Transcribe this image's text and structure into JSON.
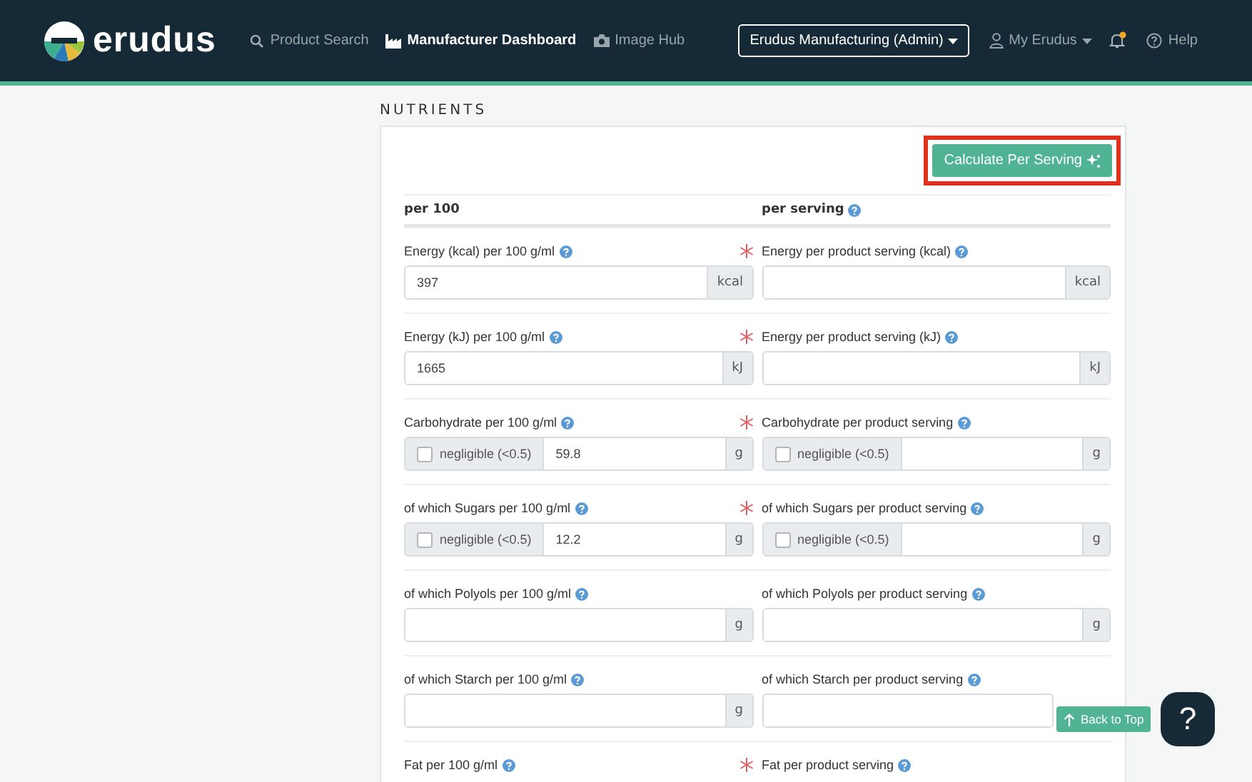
{
  "nav": {
    "brand": "erudus",
    "items": [
      {
        "label": "Product Search",
        "selected": false
      },
      {
        "label": "Manufacturer Dashboard",
        "selected": true
      },
      {
        "label": "Image Hub",
        "selected": false
      }
    ],
    "account": "Erudus Manufacturing (Admin)",
    "menu": "My Erudus",
    "notification": true,
    "help": "Help"
  },
  "section": {
    "title": "NUTRIENTS",
    "action": {
      "label": "Calculate Per Serving",
      "highlighted": true
    },
    "columns": [
      {
        "label": "per 100",
        "help": false
      },
      {
        "label": "per serving",
        "help": true
      }
    ],
    "rows": [
      {
        "required": true,
        "per100": {
          "label": "Energy (kcal) per 100 g/ml",
          "value": "397",
          "unit": "kcal"
        },
        "serving": {
          "label": "Energy per product serving (kcal)",
          "unit": "kcal"
        }
      },
      {
        "required": true,
        "per100": {
          "label": "Energy (kJ) per 100 g/ml",
          "value": "1665",
          "unit": "kJ"
        },
        "serving": {
          "label": "Energy per product serving (kJ)",
          "unit": "kJ"
        }
      },
      {
        "required": true,
        "per100": {
          "label": "Carbohydrate per 100 g/ml",
          "value": "59.8",
          "unit": "g",
          "negligible": {
            "label": "negligible (<0.5)",
            "checked": false
          }
        },
        "serving": {
          "label": "Carbohydrate per product serving",
          "unit": "g",
          "negligible": {
            "label": "negligible (<0.5)",
            "checked": false
          }
        }
      },
      {
        "required": true,
        "per100": {
          "label": "of which Sugars per 100 g/ml",
          "value": "12.2",
          "unit": "g",
          "negligible": {
            "label": "negligible (<0.5)",
            "checked": false
          }
        },
        "serving": {
          "label": "of which Sugars per product serving",
          "unit": "g",
          "negligible": {
            "label": "negligible (<0.5)",
            "checked": false
          }
        }
      },
      {
        "required": false,
        "per100": {
          "label": "of which Polyols per 100 g/ml",
          "unit": "g"
        },
        "serving": {
          "label": "of which Polyols per product serving",
          "unit": "g"
        }
      },
      {
        "required": false,
        "per100": {
          "label": "of which Starch per 100 g/ml",
          "unit": "g"
        },
        "serving": {
          "label": "of which Starch per product serving",
          "field": true
        }
      },
      {
        "required": true,
        "per100": {
          "label": "Fat per 100 g/ml"
        },
        "serving": {
          "label": "Fat per product serving"
        }
      }
    ]
  },
  "back_to_top": "Back to Top",
  "help_bubble": "?"
}
